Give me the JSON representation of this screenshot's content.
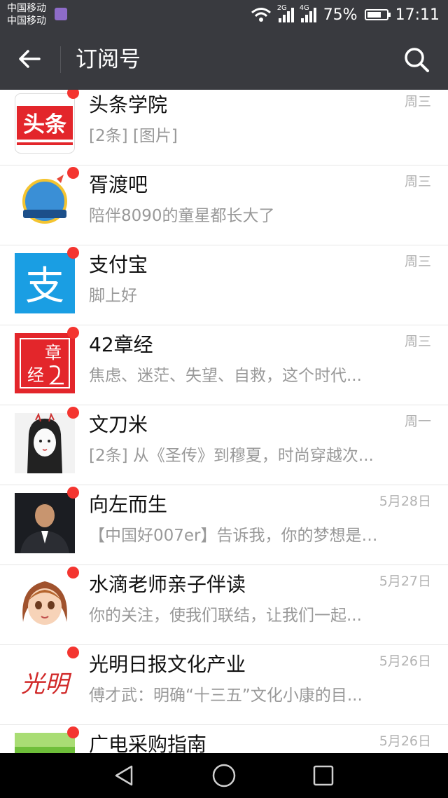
{
  "status_bar": {
    "carrier_1": "中国移动",
    "carrier_2": "中国移动",
    "net_1": "2G",
    "net_2": "4G",
    "battery": "75%",
    "battery_level": 0.75,
    "time": "17:11"
  },
  "header": {
    "title": "订阅号",
    "back_icon": "arrow-left-icon",
    "search_icon": "search-icon"
  },
  "subscriptions": [
    {
      "name": "头条学院",
      "preview": "[2条] [图片]",
      "date": "周三",
      "unread": true
    },
    {
      "name": "胥渡吧",
      "preview": "陪伴8090的童星都长大了",
      "date": "周三",
      "unread": true
    },
    {
      "name": "支付宝",
      "preview": "脚上好",
      "date": "周三",
      "unread": true
    },
    {
      "name": "42章经",
      "preview": "焦虑、迷茫、失望、自救，这个时代...",
      "date": "周三",
      "unread": true
    },
    {
      "name": "文刀米",
      "preview": "[2条] 从《圣传》到穆夏，时尚穿越次...",
      "date": "周一",
      "unread": true
    },
    {
      "name": "向左而生",
      "preview": "【中国好007er】告诉我，你的梦想是什...",
      "date": "5月28日",
      "unread": true
    },
    {
      "name": "水滴老师亲子伴读",
      "preview": "你的关注，使我们联结，让我们一起...",
      "date": "5月27日",
      "unread": true
    },
    {
      "name": "光明日报文化产业",
      "preview": "傅才武：明确“十三五”文化小康的目...",
      "date": "5月26日",
      "unread": true
    },
    {
      "name": "广电采购指南",
      "preview": "",
      "date": "5月26日",
      "unread": true
    }
  ],
  "logos": {
    "toutiao": "头条",
    "alipay": "支",
    "jing_1": "章",
    "jing_2": "经",
    "guangming": "光明"
  },
  "colors": {
    "bar": "#393a3f",
    "unread_dot": "#f43530",
    "alipay_blue": "#1a9ee3",
    "toutiao_red": "#e3262b"
  },
  "nav": {
    "back_icon": "triangle-back-icon",
    "home_icon": "circle-home-icon",
    "recent_icon": "square-recent-icon"
  }
}
